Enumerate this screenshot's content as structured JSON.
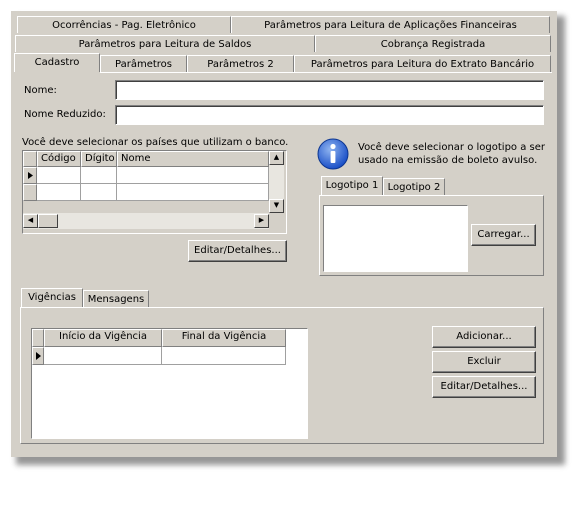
{
  "tabs_row1": [
    "Ocorrências - Pag. Eletrônico",
    "Parâmetros para Leitura de Aplicações Financeiras"
  ],
  "tabs_row2": [
    "Parâmetros para Leitura de Saldos",
    "Cobrança Registrada"
  ],
  "tabs_row3": [
    "Cadastro",
    "Parâmetros",
    "Parâmetros 2",
    "Parâmetros para Leitura do Extrato Bancário"
  ],
  "form": {
    "nome_label": "Nome:",
    "nome_value": "",
    "nome_reduzido_label": "Nome Reduzido:",
    "nome_reduzido_value": ""
  },
  "countries": {
    "instruction": "Você deve selecionar os países que utilizam o banco.",
    "columns": [
      "Código",
      "Dígito",
      "Nome"
    ],
    "edit_button": "Editar/Detalhes..."
  },
  "logo": {
    "info_text": "Você deve selecionar o logotipo a ser usado na emissão de boleto avulso.",
    "tabs": [
      "Logotipo 1",
      "Logotipo 2"
    ],
    "load_button": "Carregar..."
  },
  "vigencias": {
    "tabs": [
      "Vigências",
      "Mensagens"
    ],
    "columns": [
      "Início da Vigência",
      "Final da Vigência"
    ],
    "buttons": {
      "add": "Adicionar...",
      "delete": "Excluir",
      "edit": "Editar/Detalhes..."
    }
  },
  "icons": {
    "info": "info-icon",
    "row_pointer": "row-pointer-icon",
    "arrow_up": "arrow-up-icon",
    "arrow_down": "arrow-down-icon",
    "arrow_left": "arrow-left-icon",
    "arrow_right": "arrow-right-icon"
  }
}
